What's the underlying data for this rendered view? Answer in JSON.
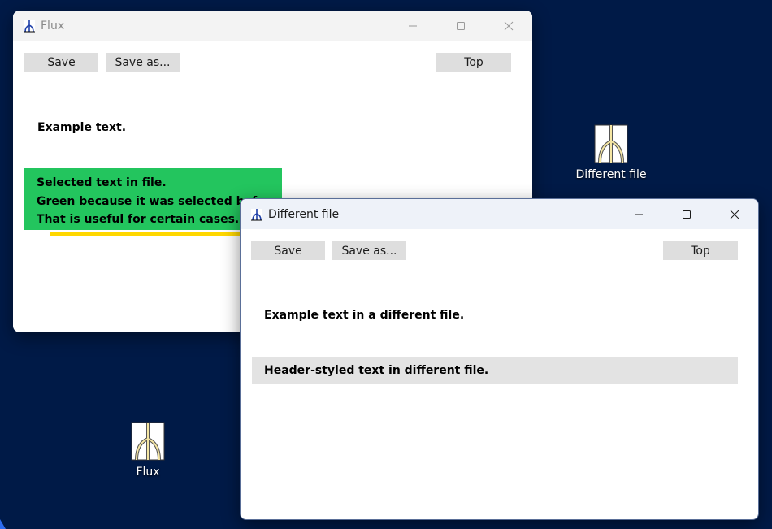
{
  "desktop": {
    "icons": [
      {
        "label": "Different file"
      },
      {
        "label": "Flux"
      }
    ]
  },
  "windows": {
    "flux": {
      "title": "Flux",
      "toolbar": {
        "save_label": "Save",
        "save_as_label": "Save as...",
        "top_label": "Top"
      },
      "example_text": "Example text.",
      "selected_lines": [
        "Selected text in file.",
        "Green because it was selected before.",
        "That is useful for certain cases."
      ],
      "highlight_color": "#23c55e",
      "underline_color": "#ffd700"
    },
    "different_file": {
      "title": "Different file",
      "toolbar": {
        "save_label": "Save",
        "save_as_label": "Save as...",
        "top_label": "Top"
      },
      "example_text": "Example text in a different file.",
      "header_text": "Header-styled text in different file."
    }
  },
  "colors": {
    "desktop_background": "#001a47",
    "button_background": "#dedede",
    "header_background": "#e3e3e3"
  }
}
